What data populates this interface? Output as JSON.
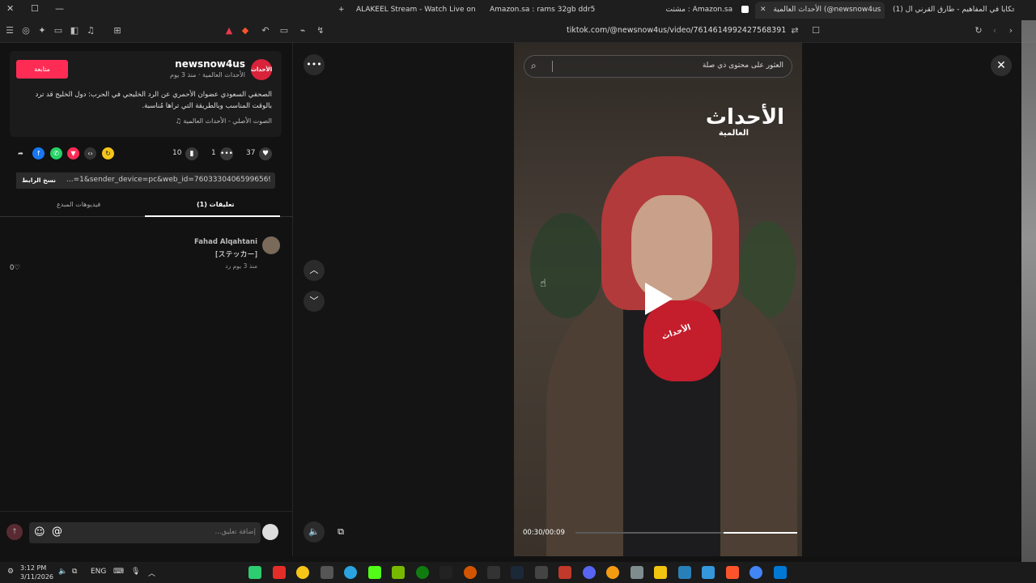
{
  "browser": {
    "tabs": [
      {
        "label": "ALAKEEL Stream - Watch Live on Kick"
      },
      {
        "label": "Amazon.sa : rams 32gb ddr5"
      },
      {
        "label": "Amazon.sa : مشتت"
      },
      {
        "label": "الأحداث العالمية (@newsnow4us"
      },
      {
        "label": "(1) حكايا في المفاهيم - طارق القرني ال"
      }
    ],
    "new_tab_label": "+",
    "url": "tiktok.com/@newsnow4us/video/7614614992427568391"
  },
  "post": {
    "author_logo_text": "الأحداث",
    "username": "newsnow4us",
    "subline": "الأحداث العالمية · منذ 3 يوم",
    "follow_label": "متابعة",
    "description": "الصحفي السعودي عضوان الأحمري عن الرد الخليجي في الحرب: دول الخليج قد ترد بالوقت المناسب وبالطريقة التي تراها مُناسبة.",
    "music": "الصوت الأصلي - الأحداث العالمية",
    "likes": "37",
    "comments": "1",
    "saves": "10",
    "link_text": "...=1&sender_device=pc&web_id=7603330406599656978",
    "copy_link_label": "نسخ الرابط"
  },
  "panel_tabs": {
    "comments": "تعليقات (1)",
    "creator_videos": "فيديوهات المبدع"
  },
  "comment": {
    "author": "Fahad Alqahtani",
    "text": "[ステッカー]",
    "meta": "منذ 3 يوم   رد",
    "likes": "0"
  },
  "comment_input": {
    "placeholder": "إضافة تعليق...",
    "mention": "@"
  },
  "video": {
    "search_placeholder": "العثور على محتوى ذي صلة",
    "watermark_title": "الأحداث",
    "watermark_subtitle": "العالمية",
    "mic_label": "الأحداث",
    "time": "00:30/00:09",
    "progress": 0.34
  },
  "taskbar": {
    "time": "3:12 PM",
    "date": "3/11/2026",
    "lang": "ENG"
  },
  "colors": {
    "accent": "#fe2c55",
    "logo_red": "#d8233a"
  }
}
